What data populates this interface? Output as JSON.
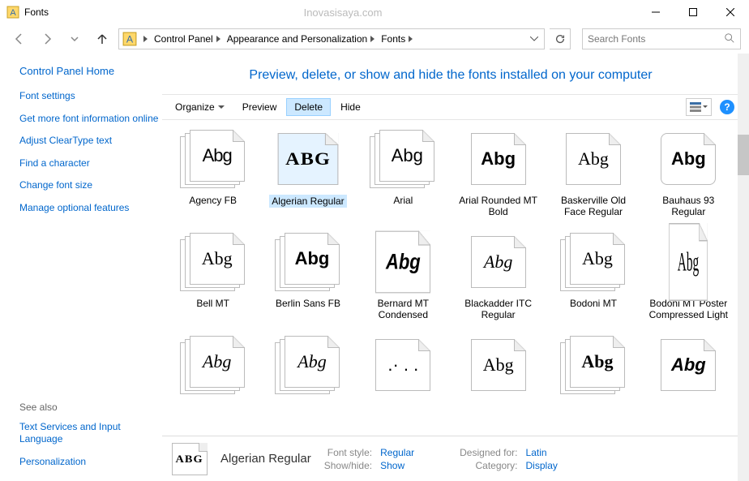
{
  "title": "Fonts",
  "watermark": "Inovasisaya.com",
  "breadcrumbs": [
    "Control Panel",
    "Appearance and Personalization",
    "Fonts"
  ],
  "search_placeholder": "Search Fonts",
  "sidebar": {
    "home": "Control Panel Home",
    "links": [
      "Font settings",
      "Get more font information online",
      "Adjust ClearType text",
      "Find a character",
      "Change font size",
      "Manage optional features"
    ],
    "see_also_label": "See also",
    "see_also": [
      "Text Services and Input Language",
      "Personalization"
    ]
  },
  "heading": "Preview, delete, or show and hide the fonts installed on your computer",
  "toolbar": {
    "organize": "Organize",
    "preview": "Preview",
    "delete": "Delete",
    "hide": "Hide"
  },
  "fonts": [
    {
      "name": "Agency FB",
      "sample": "Abg",
      "cls": "f-agency",
      "stacked": true
    },
    {
      "name": "Algerian Regular",
      "sample": "ABG",
      "cls": "f-algerian",
      "stacked": false,
      "selected": true
    },
    {
      "name": "Arial",
      "sample": "Abg",
      "cls": "f-arial",
      "stacked": true
    },
    {
      "name": "Arial Rounded MT Bold",
      "sample": "Abg",
      "cls": "f-arialrnd",
      "stacked": false
    },
    {
      "name": "Baskerville Old Face Regular",
      "sample": "Abg",
      "cls": "f-old",
      "stacked": false
    },
    {
      "name": "Bauhaus 93 Regular",
      "sample": "Abg",
      "cls": "f-bauhaus",
      "stacked": false
    },
    {
      "name": "Bell MT",
      "sample": "Abg",
      "cls": "f-bell",
      "stacked": true
    },
    {
      "name": "Berlin Sans FB",
      "sample": "Abg",
      "cls": "f-berlin",
      "stacked": true
    },
    {
      "name": "Bernard MT Condensed",
      "sample": "Abg",
      "cls": "f-bernard",
      "stacked": false
    },
    {
      "name": "Blackadder ITC Regular",
      "sample": "Abg",
      "cls": "f-blackadder",
      "stacked": false
    },
    {
      "name": "Bodoni MT",
      "sample": "Abg",
      "cls": "f-bodoni",
      "stacked": true
    },
    {
      "name": "Bodoni MT Poster Compressed Light",
      "sample": "Abg",
      "cls": "f-bodoniposter",
      "stacked": false
    },
    {
      "name": "",
      "sample": "Abg",
      "cls": "f-italic",
      "stacked": true
    },
    {
      "name": "",
      "sample": "Abg",
      "cls": "f-italic",
      "stacked": true
    },
    {
      "name": "",
      "sample": ".· . .",
      "cls": "",
      "stacked": false
    },
    {
      "name": "",
      "sample": "Abg",
      "cls": "f-script",
      "stacked": false
    },
    {
      "name": "",
      "sample": "Abg",
      "cls": "f-bold2",
      "stacked": true
    },
    {
      "name": "",
      "sample": "Abg",
      "cls": "f-bold3",
      "stacked": false
    }
  ],
  "details": {
    "name": "Algerian Regular",
    "sample": "ABG",
    "labels": {
      "style": "Font style:",
      "showhide": "Show/hide:",
      "designed": "Designed for:",
      "category": "Category:"
    },
    "values": {
      "style": "Regular",
      "showhide": "Show",
      "designed": "Latin",
      "category": "Display"
    }
  }
}
